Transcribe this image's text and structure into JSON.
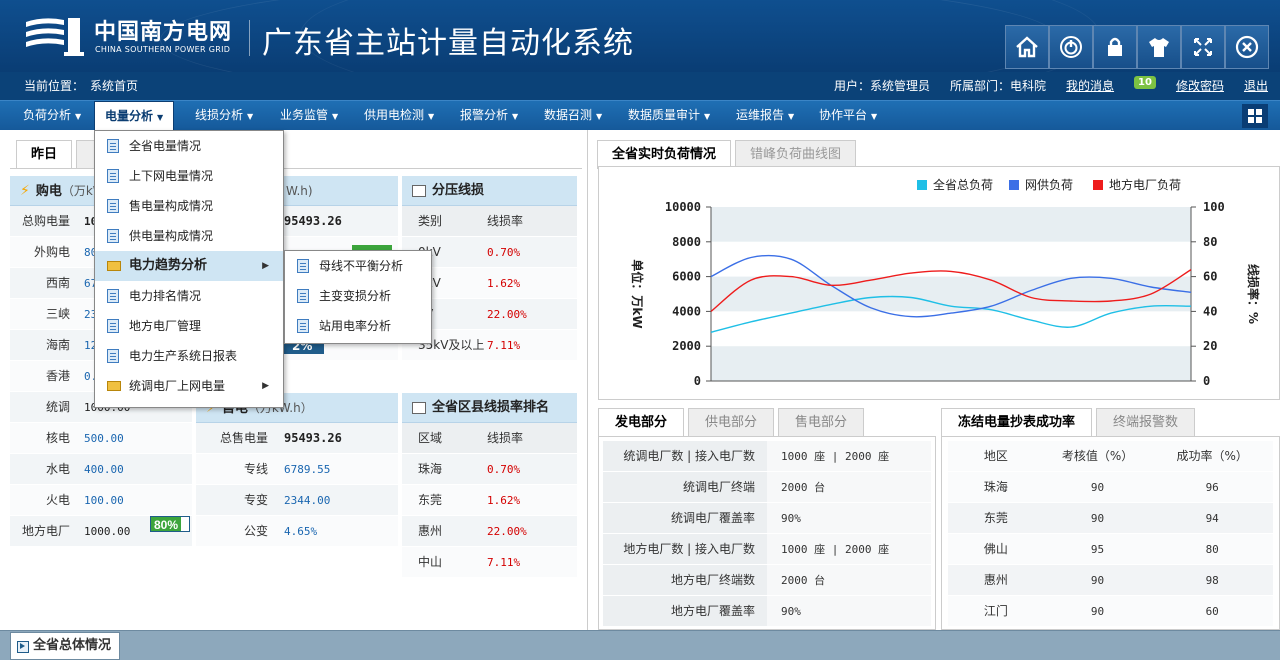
{
  "header": {
    "logo_cn": "中国南方电网",
    "logo_en": "CHINA SOUTHERN POWER GRID",
    "system_title": "广东省主站计量自动化系统",
    "buttons": [
      "home-icon",
      "power-icon",
      "lock-icon",
      "shirt-icon",
      "fullscreen-icon",
      "close-icon"
    ]
  },
  "infobar": {
    "location_label": "当前位置：",
    "location_value": "系统首页",
    "user_label": "用户：系统管理员",
    "dept_label": "所属部门：电科院",
    "messages_label": "我的消息",
    "messages_count": "10",
    "change_password": "修改密码",
    "logout": "退出"
  },
  "menu": {
    "items": [
      "负荷分析",
      "电量分析",
      "线损分析",
      "业务监管",
      "供用电检测",
      "报警分析",
      "数据召测",
      "数据质量审计",
      "运维报告",
      "协作平台"
    ]
  },
  "dropdown": {
    "items": [
      "全省电量情况",
      "上下网电量情况",
      "售电量构成情况",
      "供电量构成情况",
      "电力趋势分析",
      "电力排名情况",
      "地方电厂管理",
      "电力生产系统日报表",
      "统调电厂上网电量"
    ],
    "submenu": [
      "母线不平衡分析",
      "主变变损分析",
      "站用电率分析"
    ]
  },
  "left": {
    "tabs": [
      "昨日",
      ""
    ],
    "purchase": {
      "title": "购电",
      "unit": "（万kW.h）",
      "rows": [
        {
          "label": "总购电量",
          "value": "10",
          "bold": true
        },
        {
          "label": "外购电",
          "value": "80"
        },
        {
          "label": "西南",
          "value": "67"
        },
        {
          "label": "三峡",
          "value": "23"
        },
        {
          "label": "海南",
          "value": "12"
        },
        {
          "label": "香港",
          "value": "0."
        },
        {
          "label": "统调",
          "value": "1000.00",
          "pct": "80%"
        },
        {
          "label": "核电",
          "value": "500.00"
        },
        {
          "label": "水电",
          "value": "400.00"
        },
        {
          "label": "火电",
          "value": "100.00"
        },
        {
          "label": "地方电厂",
          "value": "1000.00",
          "pct": "80%"
        }
      ]
    },
    "supply": {
      "unit": "W.h)",
      "total_value": "95493.26",
      "partial_pct": "2%"
    },
    "sale": {
      "title": "售电",
      "unit": "（万kW.h）",
      "rows": [
        {
          "label": "总售电量",
          "value": "95493.26",
          "bold": true
        },
        {
          "label": "专线",
          "value": "6789.55"
        },
        {
          "label": "专变",
          "value": "2344.00"
        },
        {
          "label": "公变",
          "value": "4.65%"
        }
      ]
    },
    "voltage_loss": {
      "title": "分压线损",
      "col1": "类别",
      "col2": "线损率",
      "rows": [
        {
          "label": "0kV",
          "value": "0.70%"
        },
        {
          "label": "0kV",
          "value": "1.62%"
        },
        {
          "label": "kV",
          "value": "22.00%"
        },
        {
          "label": "35kV及以上",
          "value": "7.11%"
        }
      ]
    },
    "county_rank": {
      "title": "全省区县线损率排名",
      "col1": "区域",
      "col2": "线损率",
      "rows": [
        {
          "label": "珠海",
          "value": "0.70%"
        },
        {
          "label": "东莞",
          "value": "1.62%"
        },
        {
          "label": "惠州",
          "value": "22.00%"
        },
        {
          "label": "中山",
          "value": "7.11%"
        }
      ]
    }
  },
  "right": {
    "tabs": [
      "全省实时负荷情况",
      "错峰负荷曲线图"
    ],
    "legend": [
      "全省总负荷",
      "网供负荷",
      "地方电厂负荷"
    ],
    "y_left_label": "单位：万kW",
    "y_right_label": "线损率：%",
    "gen_tabs": [
      "发电部分",
      "供电部分",
      "售电部分"
    ],
    "gen_rows": [
      {
        "label": "统调电厂数 | 接入电厂数",
        "value": "1000 座 | 2000 座"
      },
      {
        "label": "统调电厂终端",
        "value": "2000 台"
      },
      {
        "label": "统调电厂覆盖率",
        "value": "90%"
      },
      {
        "label": "地方电厂数 | 接入电厂数",
        "value": "1000 座 | 2000 座"
      },
      {
        "label": "地方电厂终端数",
        "value": "2000 台"
      },
      {
        "label": "地方电厂覆盖率",
        "value": "90%"
      }
    ],
    "freeze_tabs": [
      "冻结电量抄表成功率",
      "终端报警数"
    ],
    "freeze_cols": [
      "地区",
      "考核值（%）",
      "成功率（%）"
    ],
    "freeze_rows": [
      [
        "珠海",
        "90",
        "96"
      ],
      [
        "东莞",
        "90",
        "94"
      ],
      [
        "佛山",
        "95",
        "80"
      ],
      [
        "惠州",
        "90",
        "98"
      ],
      [
        "江门",
        "90",
        "60"
      ]
    ]
  },
  "footer": {
    "tab": "全省总体情况"
  },
  "chart_data": {
    "type": "line",
    "title": "",
    "ylabel": "单位：万kW",
    "y2label": "线损率：%",
    "ylim": [
      0,
      10000
    ],
    "y2lim": [
      0,
      100
    ],
    "yticks": [
      "10000",
      "8000",
      "6000",
      "4000",
      "2000",
      "0"
    ],
    "y2ticks": [
      "100",
      "80",
      "60",
      "40",
      "20",
      "0"
    ],
    "x": [
      0,
      1,
      2,
      3,
      4,
      5,
      6,
      7,
      8,
      9,
      10,
      11,
      12
    ],
    "series": [
      {
        "name": "全省总负荷",
        "color": "#1fbfe6",
        "values": [
          2800,
          3400,
          3900,
          4400,
          4800,
          4800,
          4300,
          4100,
          3500,
          3100,
          3900,
          4300,
          4300
        ]
      },
      {
        "name": "网供负荷",
        "color": "#3b6fe6",
        "values": [
          6000,
          7100,
          7000,
          5500,
          4200,
          3700,
          3900,
          4300,
          5200,
          5900,
          5900,
          5400,
          5100
        ]
      },
      {
        "name": "地方电厂负荷",
        "color": "#ee1c1c",
        "values": [
          4000,
          5800,
          6000,
          5500,
          5800,
          6200,
          6300,
          5800,
          4800,
          4600,
          4600,
          5000,
          6400
        ]
      }
    ],
    "grid": true,
    "legend_position": "top"
  }
}
